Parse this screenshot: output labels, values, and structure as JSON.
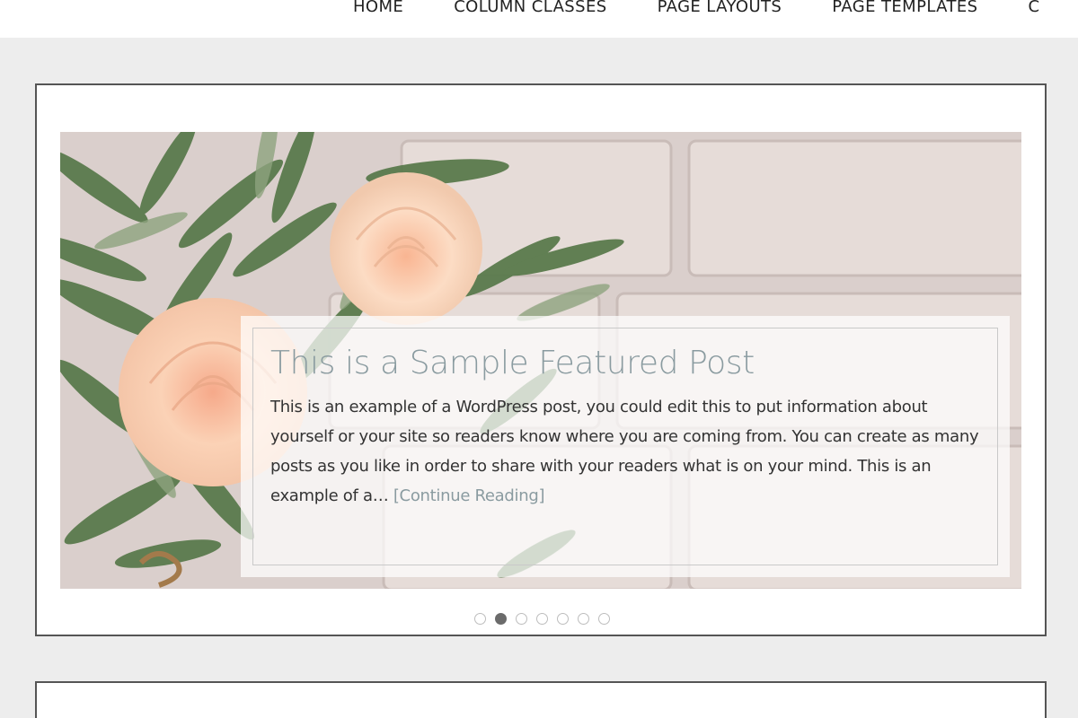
{
  "nav": {
    "items": [
      "HOME",
      "COLUMN CLASSES",
      "PAGE LAYOUTS",
      "PAGE TEMPLATES",
      "C"
    ]
  },
  "slider": {
    "title": "This is a Sample Featured Post",
    "excerpt": "This is an example of a WordPress post, you could edit this to put information about yourself or your site so readers know where you are coming from. You can create as many posts as you like in order to share with your readers what is on your mind. This is an example of a…",
    "continue_label": "[Continue Reading]",
    "dot_count": 7,
    "active_dot": 2
  },
  "colors": {
    "page_bg": "#ededed",
    "accent": "#8a9ba0",
    "text": "#333333",
    "border": "#555555"
  }
}
